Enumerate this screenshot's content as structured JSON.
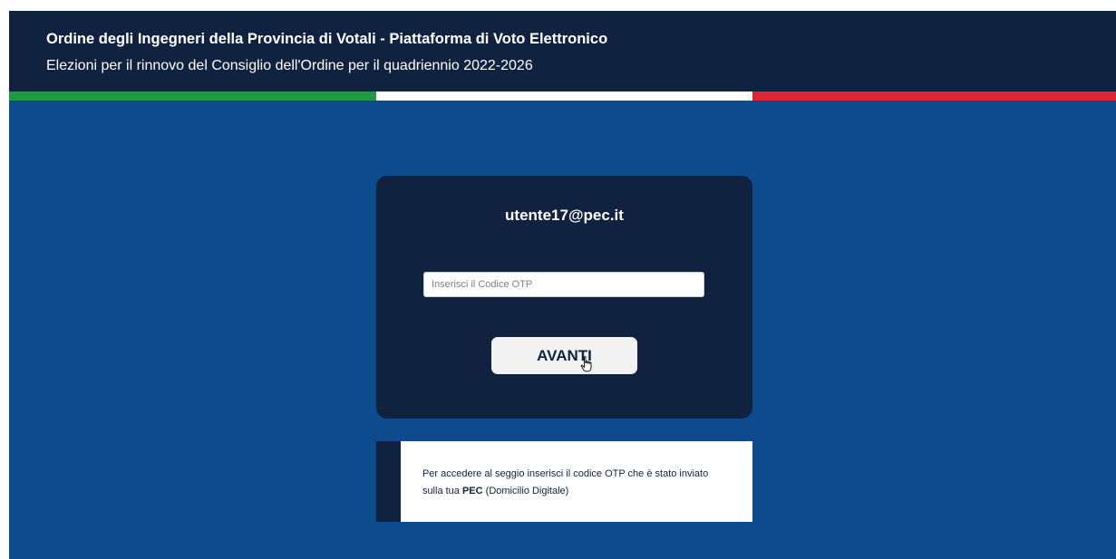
{
  "header": {
    "title": "Ordine degli Ingegneri della Provincia di Votali - Piattaforma di Voto Elettronico",
    "subtitle": "Elezioni per il rinnovo del Consiglio dell'Ordine per il quadriennio 2022-2026"
  },
  "tricolor": {
    "green": "#1f9a3f",
    "white": "#ffffff",
    "red": "#e0232c"
  },
  "colors": {
    "navy": "#10223f",
    "background_blue": "#0d4b8e"
  },
  "login": {
    "user_email": "utente17@pec.it",
    "otp_value": "",
    "otp_placeholder": "Inserisci il Codice OTP",
    "submit_label": "AVANTI"
  },
  "info": {
    "text_before": "Per accedere al seggio inserisci il codice OTP che è stato inviato sulla tua ",
    "text_bold": "PEC",
    "text_after": " (Domicilio Digitale)"
  },
  "icons": {
    "cursor": "hand-pointer-icon"
  }
}
